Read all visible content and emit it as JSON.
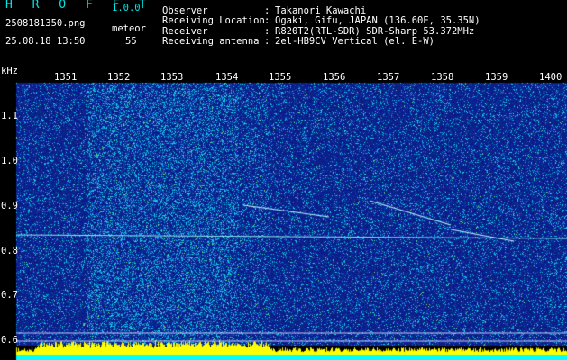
{
  "header": {
    "title": "H R O F F T",
    "version": "1.0.0",
    "file_name": "2508181350.png",
    "date_time": "25.08.18 13:50",
    "mode_label": "meteor",
    "meteor_count": "55",
    "info": [
      {
        "label": "Observer",
        "value": "Takanori Kawachi"
      },
      {
        "label": "Receiving Location",
        "value": "Ogaki, Gifu, JAPAN (136.60E, 35.35N)"
      },
      {
        "label": "Receiver",
        "value": "R820T2(RTL-SDR) SDR-Sharp 53.372MHz"
      },
      {
        "label": "Receiving antenna",
        "value": "2el-HB9CV Vertical (el. E-W)"
      }
    ],
    "separator": ":"
  },
  "plot": {
    "y_unit": "kHz",
    "x_ticks": [
      "1351",
      "1352",
      "1353",
      "1354",
      "1355",
      "1356",
      "1357",
      "1358",
      "1359",
      "1400"
    ],
    "y_ticks": [
      "1.1",
      "1.0",
      "0.9",
      "0.8",
      "0.7",
      "0.6"
    ],
    "colors": {
      "background": "#0a1a8c",
      "noise_high": "#17b4e6",
      "carrier": "#8fe8f0",
      "power_bar": "#ffff00",
      "baseline": "#00ffff"
    }
  }
}
